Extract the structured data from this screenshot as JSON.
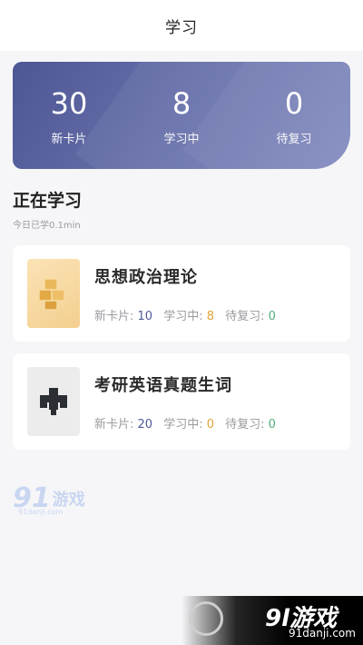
{
  "navbar": {
    "title": "学习"
  },
  "stats": [
    {
      "value": "30",
      "label": "新卡片"
    },
    {
      "value": "8",
      "label": "学习中"
    },
    {
      "value": "0",
      "label": "待复习"
    }
  ],
  "section": {
    "title": "正在学习",
    "subtitle": "今日已学0.1min"
  },
  "decks": [
    {
      "title": "思想政治理论",
      "new_label": "新卡片: ",
      "new_value": "10",
      "learning_label": "学习中: ",
      "learning_value": "8",
      "review_label": "待复习: ",
      "review_value": "0"
    },
    {
      "title": "考研英语真题生词",
      "new_label": "新卡片: ",
      "new_value": "20",
      "learning_label": "学习中: ",
      "learning_value": "0",
      "review_label": "待复习: ",
      "review_value": "0"
    }
  ],
  "watermark": {
    "left_num": "91",
    "left_text": "游戏",
    "left_url": "91danji.com",
    "corner_brand": "9l游戏",
    "corner_url": "91danji.com"
  },
  "colors": {
    "card_gradient_start": "#4e5794",
    "card_gradient_end": "#7e86bd",
    "new_count": "#4f5a98",
    "learning_count": "#e0a43a",
    "review_count": "#4fae7a"
  },
  "icons": {
    "deck_1": "gold-cubes-icon",
    "deck_2": "pixel-arrow-icon"
  }
}
